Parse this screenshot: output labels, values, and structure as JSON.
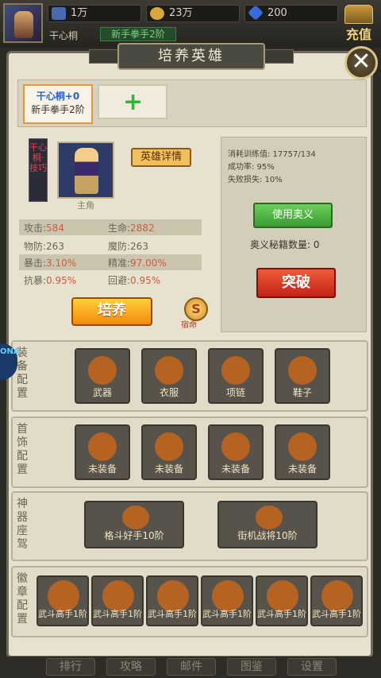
{
  "top": {
    "hero_name": "干心桐",
    "rank": "新手拳手2阶",
    "resources": [
      {
        "icon": "energy-icon",
        "value": "1万"
      },
      {
        "icon": "gold-coin-icon",
        "value": "23万"
      },
      {
        "icon": "diamond-icon",
        "value": "200"
      }
    ],
    "recharge_label": "充值"
  },
  "panel": {
    "title": "培养英雄",
    "hero_tab": {
      "name": "干心桐+0",
      "rank": "新手拳手2阶"
    },
    "add_tab_symbol": "+",
    "banner_text": "干心桐·技巧",
    "role_label": "主角",
    "detail_button": "英雄详情",
    "stats": [
      {
        "l1": "攻击:",
        "v1": "584",
        "l2": "生命:",
        "v2": "2882"
      },
      {
        "l1": "物防:",
        "v1": "263",
        "l2": "魔防:",
        "v2": "263"
      },
      {
        "l1": "暴击:",
        "v1": "3.10%",
        "l2": "精准:",
        "v2": "97.00%"
      },
      {
        "l1": "抗暴:",
        "v1": "0.95%",
        "l2": "回避:",
        "v2": "0.95%"
      }
    ],
    "cultivate_button": "培养",
    "coin_symbol": "S",
    "coin_label": "宿命",
    "training": {
      "consume": "消耗训练值: 17757/134",
      "success": "成功率: 95%",
      "fail_loss": "失败损失: 10%",
      "use_button": "使用奥义",
      "secret_count": "奥义秘籍数量:  0",
      "breakthrough_button": "突破"
    }
  },
  "sections": {
    "equip": {
      "label": "装备配置",
      "slots": [
        "武器",
        "衣服",
        "项链",
        "鞋子"
      ]
    },
    "accessory": {
      "label": "首饰配置",
      "slots": [
        "未装备",
        "未装备",
        "未装备",
        "未装备"
      ]
    },
    "artifact": {
      "label": "神器座驾",
      "slots": [
        "格斗好手10阶",
        "街机战将10阶"
      ]
    },
    "badge": {
      "label": "徽章配置",
      "slots": [
        "武斗高手1阶",
        "武斗高手1阶",
        "武斗高手1阶",
        "武斗高手1阶",
        "武斗高手1阶",
        "武斗高手1阶"
      ]
    }
  },
  "side_icon_text": "ONA",
  "nav": [
    "排行",
    "攻略",
    "邮件",
    "图鉴",
    "设置"
  ],
  "colors": {
    "accent_orange": "#f28a0e",
    "green": "#3a9a32",
    "red": "#c02414",
    "slot_bg": "#57524a"
  }
}
